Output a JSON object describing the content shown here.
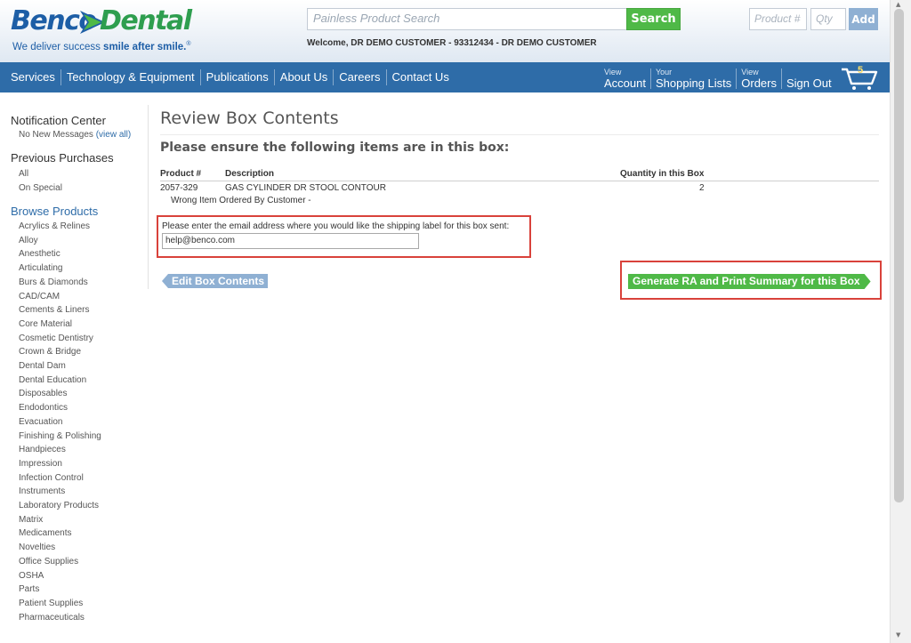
{
  "header": {
    "logo": {
      "word1": "Benco",
      "word2": "Dental",
      "tagline_prefix": "We deliver success ",
      "tagline_bold": "smile after smile.",
      "tagline_mark": "®"
    },
    "search": {
      "placeholder": "Painless Product Search",
      "button_label": "Search"
    },
    "welcome_text": "Welcome, DR DEMO CUSTOMER - 93312434 - DR DEMO CUSTOMER",
    "quick_add": {
      "product_placeholder": "Product #",
      "qty_placeholder": "Qty",
      "button_label": "Add"
    }
  },
  "nav": {
    "items": [
      "Services",
      "Technology & Equipment",
      "Publications",
      "About Us",
      "Careers",
      "Contact Us"
    ],
    "account": [
      {
        "small": "View",
        "big": "Account"
      },
      {
        "small": "Your",
        "big": "Shopping Lists"
      },
      {
        "small": "View",
        "big": "Orders"
      },
      {
        "small": "",
        "big": "Sign Out"
      }
    ],
    "cart_count": "5"
  },
  "sidebar": {
    "notification": {
      "heading": "Notification Center",
      "text": "No New Messages",
      "link": "(view all)"
    },
    "previous": {
      "heading": "Previous Purchases",
      "items": [
        "All",
        "On Special"
      ]
    },
    "browse": {
      "heading": "Browse Products",
      "categories": [
        "Acrylics & Relines",
        "Alloy",
        "Anesthetic",
        "Articulating",
        "Burs & Diamonds",
        "CAD/CAM",
        "Cements & Liners",
        "Core Material",
        "Cosmetic Dentistry",
        "Crown & Bridge",
        "Dental Dam",
        "Dental Education",
        "Disposables",
        "Endodontics",
        "Evacuation",
        "Finishing & Polishing",
        "Handpieces",
        "Impression",
        "Infection Control",
        "Instruments",
        "Laboratory Products",
        "Matrix",
        "Medicaments",
        "Novelties",
        "Office Supplies",
        "OSHA",
        "Parts",
        "Patient Supplies",
        "Pharmaceuticals"
      ]
    }
  },
  "main": {
    "title": "Review Box Contents",
    "subtitle": "Please ensure the following items are in this box:",
    "table": {
      "headers": {
        "product": "Product #",
        "description": "Description",
        "quantity": "Quantity in this Box"
      },
      "rows": [
        {
          "product": "2057-329",
          "description": "GAS CYLINDER DR STOOL CONTOUR",
          "quantity": "2",
          "reason": "Wrong Item Ordered By Customer  -"
        }
      ]
    },
    "email": {
      "label": "Please enter the email address where you would like the shipping label for this box sent:",
      "value": "help@benco.com"
    },
    "edit_button": "Edit Box Contents",
    "generate_button": "Generate RA and Print Summary for this Box"
  },
  "colors": {
    "brand_blue": "#2e6ca8",
    "brand_green": "#4fb947",
    "highlight_red": "#d9423b"
  }
}
